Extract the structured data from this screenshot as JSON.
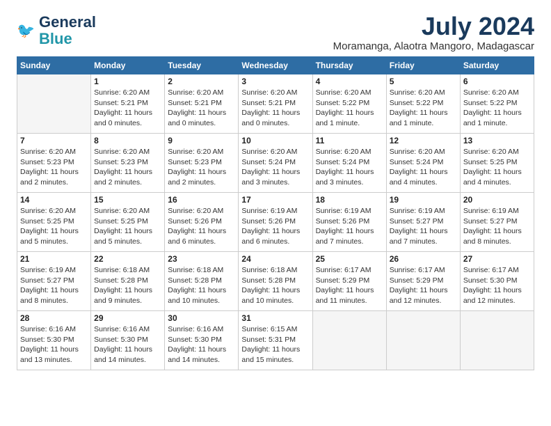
{
  "logo": {
    "line1": "General",
    "line2": "Blue"
  },
  "title": "July 2024",
  "location": "Moramanga, Alaotra Mangoro, Madagascar",
  "weekdays": [
    "Sunday",
    "Monday",
    "Tuesday",
    "Wednesday",
    "Thursday",
    "Friday",
    "Saturday"
  ],
  "weeks": [
    [
      {
        "day": "",
        "info": ""
      },
      {
        "day": "1",
        "info": "Sunrise: 6:20 AM\nSunset: 5:21 PM\nDaylight: 11 hours\nand 0 minutes."
      },
      {
        "day": "2",
        "info": "Sunrise: 6:20 AM\nSunset: 5:21 PM\nDaylight: 11 hours\nand 0 minutes."
      },
      {
        "day": "3",
        "info": "Sunrise: 6:20 AM\nSunset: 5:21 PM\nDaylight: 11 hours\nand 0 minutes."
      },
      {
        "day": "4",
        "info": "Sunrise: 6:20 AM\nSunset: 5:22 PM\nDaylight: 11 hours\nand 1 minute."
      },
      {
        "day": "5",
        "info": "Sunrise: 6:20 AM\nSunset: 5:22 PM\nDaylight: 11 hours\nand 1 minute."
      },
      {
        "day": "6",
        "info": "Sunrise: 6:20 AM\nSunset: 5:22 PM\nDaylight: 11 hours\nand 1 minute."
      }
    ],
    [
      {
        "day": "7",
        "info": "Sunrise: 6:20 AM\nSunset: 5:23 PM\nDaylight: 11 hours\nand 2 minutes."
      },
      {
        "day": "8",
        "info": "Sunrise: 6:20 AM\nSunset: 5:23 PM\nDaylight: 11 hours\nand 2 minutes."
      },
      {
        "day": "9",
        "info": "Sunrise: 6:20 AM\nSunset: 5:23 PM\nDaylight: 11 hours\nand 2 minutes."
      },
      {
        "day": "10",
        "info": "Sunrise: 6:20 AM\nSunset: 5:24 PM\nDaylight: 11 hours\nand 3 minutes."
      },
      {
        "day": "11",
        "info": "Sunrise: 6:20 AM\nSunset: 5:24 PM\nDaylight: 11 hours\nand 3 minutes."
      },
      {
        "day": "12",
        "info": "Sunrise: 6:20 AM\nSunset: 5:24 PM\nDaylight: 11 hours\nand 4 minutes."
      },
      {
        "day": "13",
        "info": "Sunrise: 6:20 AM\nSunset: 5:25 PM\nDaylight: 11 hours\nand 4 minutes."
      }
    ],
    [
      {
        "day": "14",
        "info": "Sunrise: 6:20 AM\nSunset: 5:25 PM\nDaylight: 11 hours\nand 5 minutes."
      },
      {
        "day": "15",
        "info": "Sunrise: 6:20 AM\nSunset: 5:25 PM\nDaylight: 11 hours\nand 5 minutes."
      },
      {
        "day": "16",
        "info": "Sunrise: 6:20 AM\nSunset: 5:26 PM\nDaylight: 11 hours\nand 6 minutes."
      },
      {
        "day": "17",
        "info": "Sunrise: 6:19 AM\nSunset: 5:26 PM\nDaylight: 11 hours\nand 6 minutes."
      },
      {
        "day": "18",
        "info": "Sunrise: 6:19 AM\nSunset: 5:26 PM\nDaylight: 11 hours\nand 7 minutes."
      },
      {
        "day": "19",
        "info": "Sunrise: 6:19 AM\nSunset: 5:27 PM\nDaylight: 11 hours\nand 7 minutes."
      },
      {
        "day": "20",
        "info": "Sunrise: 6:19 AM\nSunset: 5:27 PM\nDaylight: 11 hours\nand 8 minutes."
      }
    ],
    [
      {
        "day": "21",
        "info": "Sunrise: 6:19 AM\nSunset: 5:27 PM\nDaylight: 11 hours\nand 8 minutes."
      },
      {
        "day": "22",
        "info": "Sunrise: 6:18 AM\nSunset: 5:28 PM\nDaylight: 11 hours\nand 9 minutes."
      },
      {
        "day": "23",
        "info": "Sunrise: 6:18 AM\nSunset: 5:28 PM\nDaylight: 11 hours\nand 10 minutes."
      },
      {
        "day": "24",
        "info": "Sunrise: 6:18 AM\nSunset: 5:28 PM\nDaylight: 11 hours\nand 10 minutes."
      },
      {
        "day": "25",
        "info": "Sunrise: 6:17 AM\nSunset: 5:29 PM\nDaylight: 11 hours\nand 11 minutes."
      },
      {
        "day": "26",
        "info": "Sunrise: 6:17 AM\nSunset: 5:29 PM\nDaylight: 11 hours\nand 12 minutes."
      },
      {
        "day": "27",
        "info": "Sunrise: 6:17 AM\nSunset: 5:30 PM\nDaylight: 11 hours\nand 12 minutes."
      }
    ],
    [
      {
        "day": "28",
        "info": "Sunrise: 6:16 AM\nSunset: 5:30 PM\nDaylight: 11 hours\nand 13 minutes."
      },
      {
        "day": "29",
        "info": "Sunrise: 6:16 AM\nSunset: 5:30 PM\nDaylight: 11 hours\nand 14 minutes."
      },
      {
        "day": "30",
        "info": "Sunrise: 6:16 AM\nSunset: 5:30 PM\nDaylight: 11 hours\nand 14 minutes."
      },
      {
        "day": "31",
        "info": "Sunrise: 6:15 AM\nSunset: 5:31 PM\nDaylight: 11 hours\nand 15 minutes."
      },
      {
        "day": "",
        "info": ""
      },
      {
        "day": "",
        "info": ""
      },
      {
        "day": "",
        "info": ""
      }
    ]
  ]
}
